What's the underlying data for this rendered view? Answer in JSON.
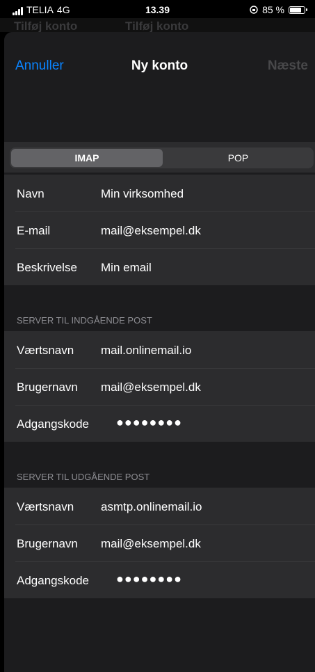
{
  "status_bar": {
    "carrier": "TELIA",
    "network": "4G",
    "time": "13.39",
    "battery_percent_label": "85 %",
    "battery_level": 0.85,
    "alarm_icon": "rotation-lock-icon"
  },
  "background_nav": {
    "back_label": "Tilføj konto",
    "title": "Tilføj konto"
  },
  "nav": {
    "cancel_label": "Annuller",
    "title": "Ny konto",
    "next_label": "Næste",
    "accent_color": "#0a84ff"
  },
  "segmented": {
    "options": [
      "IMAP",
      "POP"
    ],
    "selected": "IMAP"
  },
  "account": {
    "name_label": "Navn",
    "name_value": "Min virksomhed",
    "email_label": "E-mail",
    "email_value": "mail@eksempel.dk",
    "description_label": "Beskrivelse",
    "description_value": "Min email"
  },
  "incoming": {
    "header": "SERVER TIL INDGÅENDE POST",
    "host_label": "Værtsnavn",
    "host_value": "mail.onlinemail.io",
    "user_label": "Brugernavn",
    "user_value": "mail@eksempel.dk",
    "password_label": "Adgangskode",
    "password_value": "●●●●●●●●"
  },
  "outgoing": {
    "header": "SERVER TIL UDGÅENDE POST",
    "host_label": "Værtsnavn",
    "host_value": "asmtp.onlinemail.io",
    "user_label": "Brugernavn",
    "user_value": "mail@eksempel.dk",
    "password_label": "Adgangskode",
    "password_value": "●●●●●●●●"
  }
}
